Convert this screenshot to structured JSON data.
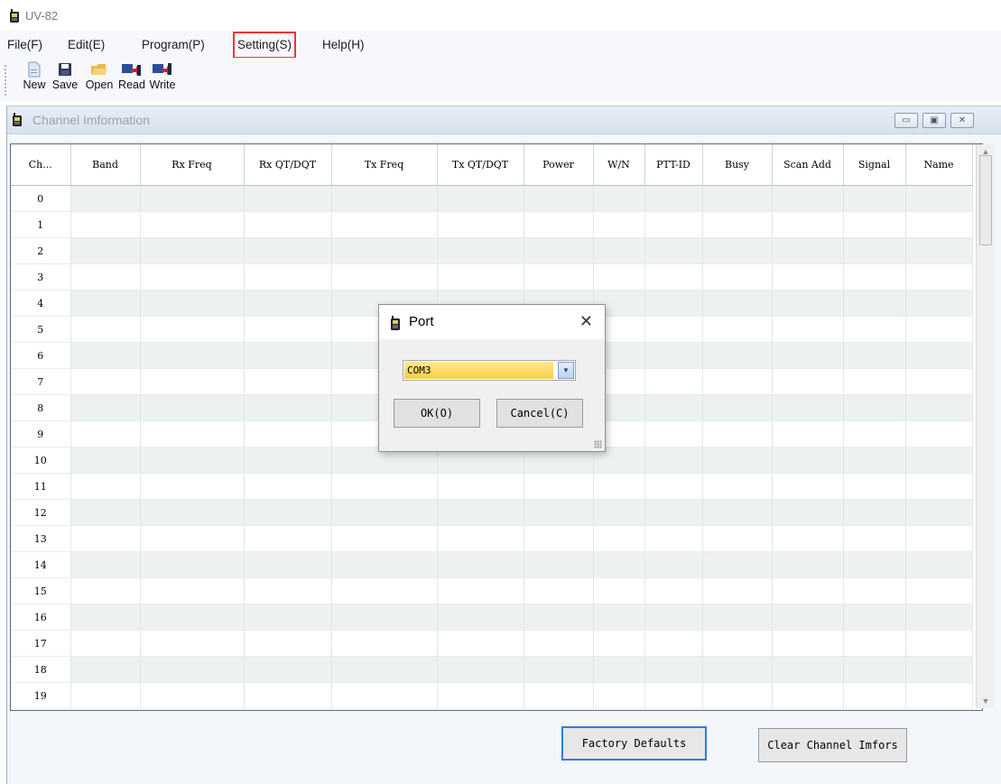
{
  "app": {
    "title": "UV-82"
  },
  "menu": {
    "items": [
      {
        "label": "File(F)"
      },
      {
        "label": "Edit(E)"
      },
      {
        "label": "Program(P)"
      },
      {
        "label": "Setting(S)",
        "highlighted": true
      },
      {
        "label": "Help(H)"
      }
    ]
  },
  "toolbar": {
    "new_label": "New",
    "save_label": "Save",
    "open_label": "Open",
    "read_label": "Read",
    "write_label": "Write"
  },
  "child_window": {
    "title": "Channel Imformation",
    "buttons": [
      "minimize-icon",
      "restore-icon",
      "close-icon"
    ]
  },
  "grid": {
    "columns": [
      "Ch...",
      "Band",
      "Rx Freq",
      "Rx QT/DQT",
      "Tx Freq",
      "Tx QT/DQT",
      "Power",
      "W/N",
      "PTT-ID",
      "Busy",
      "Scan Add",
      "Signal",
      "Name"
    ],
    "rows": [
      "0",
      "1",
      "2",
      "3",
      "4",
      "5",
      "6",
      "7",
      "8",
      "9",
      "10",
      "11",
      "12",
      "13",
      "14",
      "15",
      "16",
      "17",
      "18",
      "19"
    ]
  },
  "bottom_buttons": {
    "factory_defaults": "Factory Defaults",
    "clear_channel": "Clear Channel Imfors"
  },
  "port_dialog": {
    "title": "Port",
    "selected_port": "COM3",
    "ok_label": "OK(O)",
    "cancel_label": "Cancel(C)"
  },
  "colors": {
    "highlight_outline": "#e53935",
    "focus_border": "#2f7fd1",
    "select_highlight": "#f6cf48",
    "grid_alt_row": "#edf2f0"
  }
}
